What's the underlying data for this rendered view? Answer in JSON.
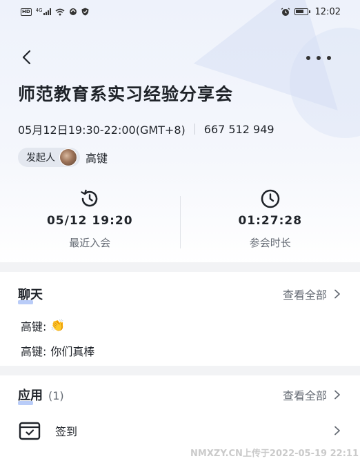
{
  "status_bar": {
    "left_icons": [
      "hd-icon",
      "signal-icon",
      "wifi-icon",
      "data-saver-icon",
      "shield-icon"
    ],
    "network_label": "4G",
    "time": "12:02"
  },
  "meeting": {
    "title": "师范教育系实习经验分享会",
    "schedule": "05月12日19:30-22:00(GMT+8)",
    "meeting_id": "667 512 949",
    "host_label": "发起人",
    "host_name": "高键"
  },
  "stats": [
    {
      "icon": "history-clock-icon",
      "value": "05/12 19:20",
      "label": "最近入会"
    },
    {
      "icon": "clock-icon",
      "value": "01:27:28",
      "label": "参会时长"
    }
  ],
  "chat": {
    "title": "聊天",
    "view_all": "查看全部",
    "messages": [
      {
        "sender": "高键:",
        "text": "👏"
      },
      {
        "sender": "高键:",
        "text": "你们真棒"
      }
    ]
  },
  "apps": {
    "title": "应用",
    "count": "(1)",
    "view_all": "查看全部",
    "items": [
      {
        "icon": "calendar-check-icon",
        "label": "签到"
      }
    ]
  },
  "watermark": "NMXZY.CN上传于2022-05-19 22:11",
  "colors": {
    "accent_underline": "#b9ccf8",
    "text_primary": "#1f2329",
    "text_secondary": "#646a73",
    "band": "#f2f3f5"
  }
}
